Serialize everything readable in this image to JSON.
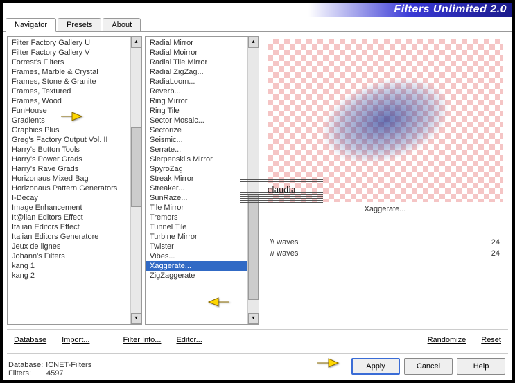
{
  "title": "Filters Unlimited 2.0",
  "tabs": [
    "Navigator",
    "Presets",
    "About"
  ],
  "activeTab": 0,
  "categories": [
    "Filter Factory Gallery U",
    "Filter Factory Gallery V",
    "Forrest's Filters",
    "Frames, Marble & Crystal",
    "Frames, Stone & Granite",
    "Frames, Textured",
    "Frames, Wood",
    "FunHouse",
    "Gradients",
    "Graphics Plus",
    "Greg's Factory Output Vol. II",
    "Harry's Button Tools",
    "Harry's Power Grads",
    "Harry's Rave Grads",
    "Horizonaus Mixed Bag",
    "Horizonaus Pattern Generators",
    "I-Decay",
    "Image Enhancement",
    "It@lian Editors Effect",
    "Italian Editors Effect",
    "Italian Editors Generatore",
    "Jeux de lignes",
    "Johann's Filters",
    "kang 1",
    "kang 2"
  ],
  "selectedCategory": null,
  "filters": [
    "Radial Mirror",
    "Radial Moirror",
    "Radial Tile Mirror",
    "Radial ZigZag...",
    "RadiaLoom...",
    "Reverb...",
    "Ring Mirror",
    "Ring Tile",
    "Sector Mosaic...",
    "Sectorize",
    "Seismic...",
    "Serrate...",
    "Sierpenski's Mirror",
    "SpyroZag",
    "Streak Mirror",
    "Streaker...",
    "SunRaze...",
    "Tile Mirror",
    "Tremors",
    "Tunnel Tile",
    "Turbine Mirror",
    "Twister",
    "Vibes...",
    "Xaggerate...",
    "ZigZaggerate"
  ],
  "selectedFilter": 23,
  "currentFilterName": "Xaggerate...",
  "params": [
    {
      "name": "\\\\ waves",
      "value": "24"
    },
    {
      "name": "// waves",
      "value": "24"
    }
  ],
  "buttons": {
    "database": "Database",
    "import": "Import...",
    "filterInfo": "Filter Info...",
    "editor": "Editor...",
    "randomize": "Randomize",
    "reset": "Reset"
  },
  "status": {
    "dbLabel": "Database:",
    "dbName": "ICNET-Filters",
    "filtersLabel": "Filters:",
    "filterCount": "4597"
  },
  "mainButtons": {
    "apply": "Apply",
    "cancel": "Cancel",
    "help": "Help"
  },
  "watermark": "claudia"
}
